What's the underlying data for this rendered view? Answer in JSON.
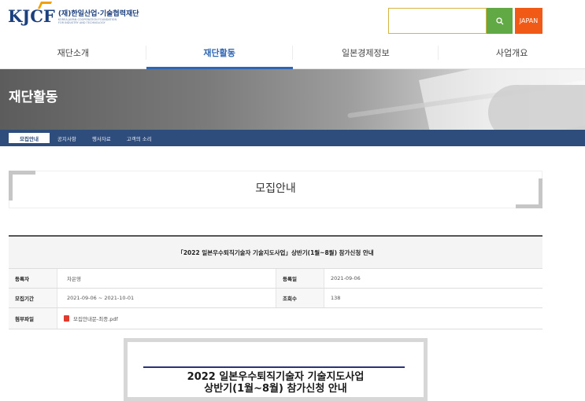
{
  "header": {
    "logo_mark": "KJCF",
    "logo_kor": "(재)한일산업·기술협력재단",
    "logo_eng_1": "KOREA-JAPAN COOPERATION FOUNDATION",
    "logo_eng_2": "FOR INDUSTRY AND TECHNOLOGY",
    "search_placeholder": "",
    "japan_label": "JAPAN"
  },
  "gnb": {
    "items": [
      {
        "label": "재단소개"
      },
      {
        "label": "재단활동"
      },
      {
        "label": "일본경제정보"
      },
      {
        "label": "사업개요"
      }
    ]
  },
  "banner": {
    "title": "재단활동"
  },
  "lnb": {
    "items": [
      {
        "label": "모집안내"
      },
      {
        "label": "공지사항"
      },
      {
        "label": "행사자료"
      },
      {
        "label": "고객의 소리"
      }
    ]
  },
  "page_title": "모집안내",
  "post": {
    "title": "「2022 일본우수퇴직기술자 기술지도사업」상반기(1월~8월) 참가신청 안내",
    "author_label": "등록자",
    "author": "차은영",
    "date_label": "등록일",
    "date": "2021-09-06",
    "period_label": "모집기간",
    "period": "2021-09-06 ~ 2021-10-01",
    "views_label": "조회수",
    "views": "138",
    "file_label": "첨부파일",
    "file_name": "모집안내문-최종.pdf"
  },
  "poster": {
    "line1": "2022 일본우수퇴직기술자 기술지도사업",
    "line2": "상반기(1월~8월) 참가신청 안내"
  },
  "colors": {
    "brand_blue": "#1c3f7d",
    "active_blue": "#2f66b4",
    "search_green": "#60a945",
    "japan_orange": "#f05a16",
    "lnb_bg": "#2e4c7c"
  }
}
